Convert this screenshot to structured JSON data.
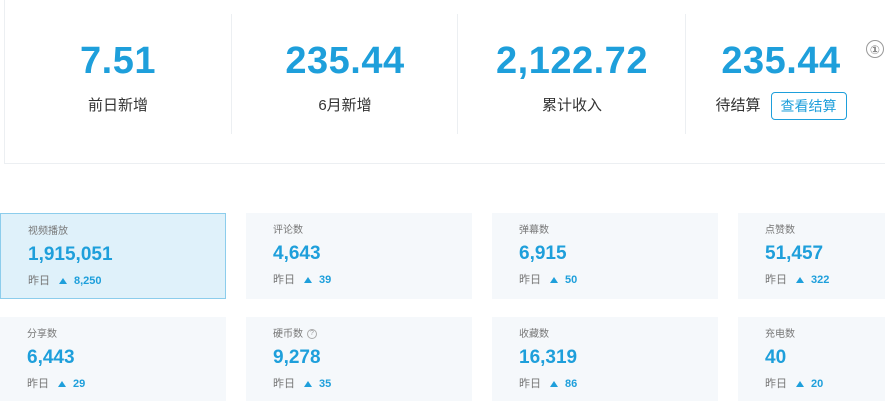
{
  "summary": [
    {
      "value": "7.51",
      "label": "前日新增"
    },
    {
      "value": "235.44",
      "label": "6月新增"
    },
    {
      "value": "2,122.72",
      "label": "累计收入"
    },
    {
      "value": "235.44",
      "label": "待结算",
      "button": "查看结算",
      "info_icon": "①"
    }
  ],
  "cards": [
    {
      "label": "视频播放",
      "value": "1,915,051",
      "prev_label": "昨日",
      "delta": "8,250"
    },
    {
      "label": "评论数",
      "value": "4,643",
      "prev_label": "昨日",
      "delta": "39"
    },
    {
      "label": "弹幕数",
      "value": "6,915",
      "prev_label": "昨日",
      "delta": "50"
    },
    {
      "label": "点赞数",
      "value": "51,457",
      "prev_label": "昨日",
      "delta": "322"
    },
    {
      "label": "分享数",
      "value": "6,443",
      "prev_label": "昨日",
      "delta": "29"
    },
    {
      "label": "硬币数",
      "value": "9,278",
      "prev_label": "昨日",
      "delta": "35"
    },
    {
      "label": "收藏数",
      "value": "16,319",
      "prev_label": "昨日",
      "delta": "86"
    },
    {
      "label": "充电数",
      "value": "40",
      "prev_label": "昨日",
      "delta": "20"
    }
  ],
  "colors": {
    "accent": "#1e9fdb",
    "card_bg": "#f5f8fb",
    "active_bg": "#dff1fa"
  }
}
